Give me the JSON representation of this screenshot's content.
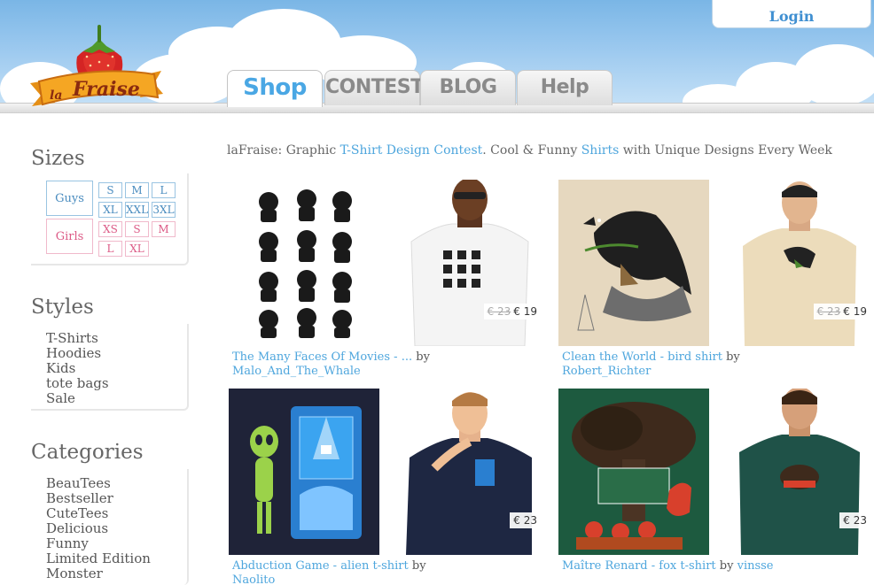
{
  "header": {
    "login_label": "Login",
    "logo_text": "la Fraise",
    "tabs": [
      {
        "label": "Shop",
        "active": true
      },
      {
        "label": "CONTEST",
        "active": false
      },
      {
        "label": "BLOG",
        "active": false
      },
      {
        "label": "Help",
        "active": false
      }
    ]
  },
  "tagline": {
    "prefix": "laFraise: Graphic ",
    "link1": "T-Shirt Design Contest",
    "mid": ". Cool & Funny ",
    "link2": "Shirts",
    "suffix": " with Unique Designs Every Week"
  },
  "sidebar": {
    "sizes": {
      "title": "Sizes",
      "guys_label": "Guys",
      "girls_label": "Girls",
      "guys": [
        "S",
        "M",
        "L",
        "XL",
        "XXL",
        "3XL"
      ],
      "girls": [
        "XS",
        "S",
        "M",
        "L",
        "XL"
      ]
    },
    "styles": {
      "title": "Styles",
      "items": [
        "T-Shirts",
        "Hoodies",
        "Kids",
        "tote bags",
        "Sale"
      ]
    },
    "categories": {
      "title": "Categories",
      "items": [
        "BeauTees",
        "Bestseller",
        "CuteTees",
        "Delicious",
        "Funny",
        "Limited Edition",
        "Monster"
      ]
    }
  },
  "products": [
    {
      "title": "The Many Faces Of Movies - ...",
      "by": "by",
      "author": "Malo_And_The_Whale",
      "old_price": "€ 23",
      "price": "€ 19"
    },
    {
      "title": "Clean the World - bird shirt",
      "by": "by",
      "author": "Robert_Richter",
      "old_price": "€ 23",
      "price": "€ 19"
    },
    {
      "title": "Abduction Game - alien t-shirt",
      "by": "by",
      "author": "Naolito",
      "old_price": "",
      "price": "€ 23"
    },
    {
      "title": "Maître Renard - fox t-shirt",
      "by": "by",
      "author": "vinsse",
      "old_price": "",
      "price": "€ 23"
    }
  ],
  "colors": {
    "accent_blue": "#4ea6dd",
    "girls_pink": "#dc5a86",
    "sky": "#7ab6e6"
  }
}
